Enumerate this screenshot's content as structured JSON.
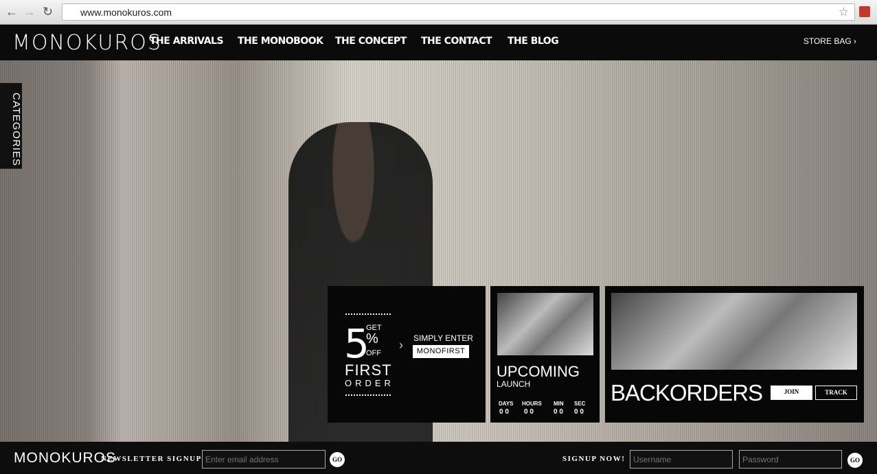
{
  "browser": {
    "url": "www.monokuros.com"
  },
  "nav": {
    "logo": "MONOKUROS",
    "items": [
      "THE ARRIVALS",
      "THE MONOBOOK",
      "THE CONCEPT",
      "THE CONTACT",
      "THE BLOG"
    ],
    "store_bag": "STORE BAG ›"
  },
  "sidebar": {
    "categories": "CATEGORIES"
  },
  "promo": {
    "number": "5",
    "get": "GET",
    "percent": "%",
    "off": "OFF",
    "first": "FIRST",
    "order": "ORDER",
    "arrow": "›",
    "simply_enter": "SIMPLY ENTER",
    "code": "MONOFIRST"
  },
  "upcoming": {
    "title": "UPCOMING",
    "subtitle": "LAUNCH",
    "labels": [
      "DAYS",
      "HOURS",
      "MIN",
      "SEC"
    ],
    "values": [
      "0 0",
      "0 0",
      "0 0",
      "0 0"
    ]
  },
  "backorders": {
    "title": "BACKORDERS",
    "join": "JOIN",
    "track": "TRACK"
  },
  "footer": {
    "logo": "MONOKUROS",
    "newsletter": "NEWSLETTER SIGNUP",
    "email_placeholder": "Enter email address",
    "go": "GO",
    "signup_now": "SIGNUP NOW!",
    "username_placeholder": "Username",
    "password_placeholder": "Password"
  }
}
